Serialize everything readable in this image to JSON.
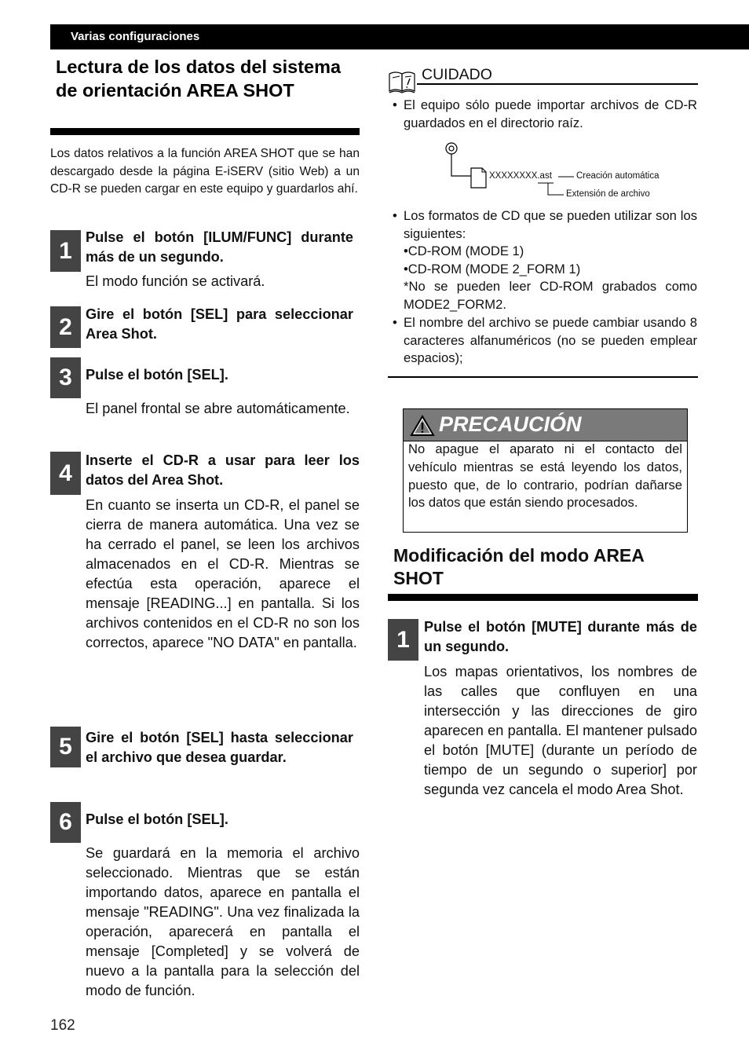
{
  "header": {
    "section": "Varias configuraciones"
  },
  "left": {
    "title": "Lectura de los datos del sistema de orientación AREA SHOT",
    "intro": "Los datos relativos a la función AREA SHOT que se han descargado desde la página E-iSERV (sitio Web)  a un CD-R se pueden cargar en este equipo y guardarlos ahí.",
    "steps": [
      {
        "num": "1",
        "title": "Pulse el botón [ILUM/FUNC] durante más de un segundo.",
        "body": "El modo función se activará."
      },
      {
        "num": "2",
        "title": "Gire el botón [SEL] para seleccionar Area Shot.",
        "body": ""
      },
      {
        "num": "3",
        "title": "Pulse el botón [SEL].",
        "body": "El panel frontal se abre automáticamente."
      },
      {
        "num": "4",
        "title": "Inserte el CD-R a usar para leer los datos del Area Shot.",
        "body": "En cuanto se inserta un CD-R, el panel se cierra de manera automática. Una vez se ha cerrado el panel, se leen los archivos almacenados en el CD-R. Mientras se efectúa esta operación, aparece el mensaje [READING...] en pantalla. Si los archivos contenidos en el CD-R no son los correctos, aparece \"NO DATA\" en pantalla."
      },
      {
        "num": "5",
        "title": "Gire el botón [SEL] hasta seleccionar el archivo que desea guardar.",
        "body": ""
      },
      {
        "num": "6",
        "title": "Pulse el botón [SEL].",
        "body": "Se guardará en la memoria el archivo seleccionado. Mientras que se están importando datos, aparece en pantalla el mensaje \"READING\". Una vez finalizada la operación, aparecerá en pantalla el mensaje [Completed] y se volverá de nuevo a la pantalla para la selección del modo de función."
      }
    ]
  },
  "cuidado": {
    "label": "CUIDADO",
    "icon": "book-caution-icon",
    "bullets": [
      {
        "text": "El equipo sólo puede importar archivos de CD-R guardados en el directorio raíz."
      },
      {
        "text": "Los formatos de CD que se pueden utilizar son los siguientes:",
        "sub": [
          "•CD-ROM (MODE 1)",
          "•CD-ROM (MODE 2_FORM 1)",
          "*No se pueden leer CD-ROM grabados como MODE2_FORM2."
        ]
      },
      {
        "text": "El nombre del archivo se puede cambiar usando 8 caracteres alfanuméricos (no se pueden emplear espacios);"
      }
    ],
    "diagram": {
      "filename": "XXXXXXXX.ast",
      "label_name": "Creación automática",
      "label_ext": "Extensión de archivo"
    }
  },
  "precaucion": {
    "title": "PRECAUCIÓN",
    "icon": "warning-triangle-icon",
    "text": "No apague el aparato ni el contacto del vehículo mientras se está leyendo los datos, puesto que, de lo contrario, podrían dañarse los datos que están siendo procesados."
  },
  "right": {
    "title": "Modificación del modo AREA SHOT",
    "steps": [
      {
        "num": "1",
        "title": "Pulse el botón [MUTE] durante más de un segundo.",
        "body": "Los mapas orientativos, los nombres de las calles que confluyen en una intersección y las direcciones de giro aparecen en pantalla. El mantener pulsado el botón [MUTE] (durante un período de tiempo de un segundo o superior] por segunda vez cancela el modo Area Shot."
      }
    ]
  },
  "footer": {
    "page_number": "162"
  }
}
